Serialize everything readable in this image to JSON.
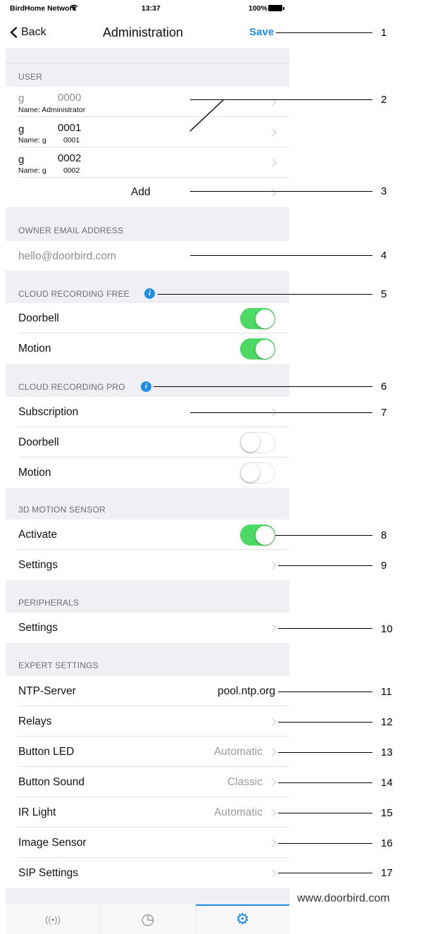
{
  "status_bar": {
    "carrier": "BirdHome Network",
    "time": "13:37",
    "battery": "100%"
  },
  "nav": {
    "back_label": "Back",
    "title": "Administration",
    "save_label": "Save"
  },
  "user_section": {
    "header": "USER",
    "users": [
      {
        "letter": "g",
        "number": "0000",
        "name": "Name: Administrator"
      },
      {
        "letter": "g",
        "number": "0001",
        "name": "Name: g",
        "name_suffix": "0001"
      },
      {
        "letter": "g",
        "number": "0002",
        "name": "Name: g",
        "name_suffix": "0002"
      }
    ],
    "add_label": "Add"
  },
  "owner_email": {
    "header": "OWNER EMAIL ADDRESS",
    "value": "hello@doorbird.com"
  },
  "cloud_free": {
    "header": "CLOUD RECORDING FREE",
    "doorbell_label": "Doorbell",
    "doorbell_on": true,
    "motion_label": "Motion",
    "motion_on": true
  },
  "cloud_pro": {
    "header": "CLOUD RECORDING PRO",
    "subscription_label": "Subscription",
    "doorbell_label": "Doorbell",
    "doorbell_on": false,
    "motion_label": "Motion",
    "motion_on": false
  },
  "motion_sensor": {
    "header": "3D MOTION SENSOR",
    "activate_label": "Activate",
    "activate_on": true,
    "settings_label": "Settings"
  },
  "peripherals": {
    "header": "PERIPHERALS",
    "settings_label": "Settings"
  },
  "expert": {
    "header": "EXPERT SETTINGS",
    "ntp_label": "NTP-Server",
    "ntp_value": "pool.ntp.org",
    "relays_label": "Relays",
    "led_label": "Button LED",
    "led_value": "Automatic",
    "sound_label": "Button Sound",
    "sound_value": "Classic",
    "ir_label": "IR Light",
    "ir_value": "Automatic",
    "image_label": "Image Sensor",
    "sip_label": "SIP Settings"
  },
  "tabs": [
    {
      "icon": "live-icon",
      "glyph": "((•))"
    },
    {
      "icon": "history-icon",
      "glyph": "◷"
    },
    {
      "icon": "settings-gear-icon",
      "glyph": "⚙"
    }
  ],
  "callouts": [
    "1",
    "2",
    "3",
    "4",
    "5",
    "6",
    "7",
    "8",
    "9",
    "10",
    "11",
    "12",
    "13",
    "14",
    "15",
    "16",
    "17"
  ],
  "watermark": "www.doorbird.com",
  "colors": {
    "accent": "#1f8dea",
    "toggle_on": "#4cd964",
    "section_bg": "#efeff4"
  }
}
